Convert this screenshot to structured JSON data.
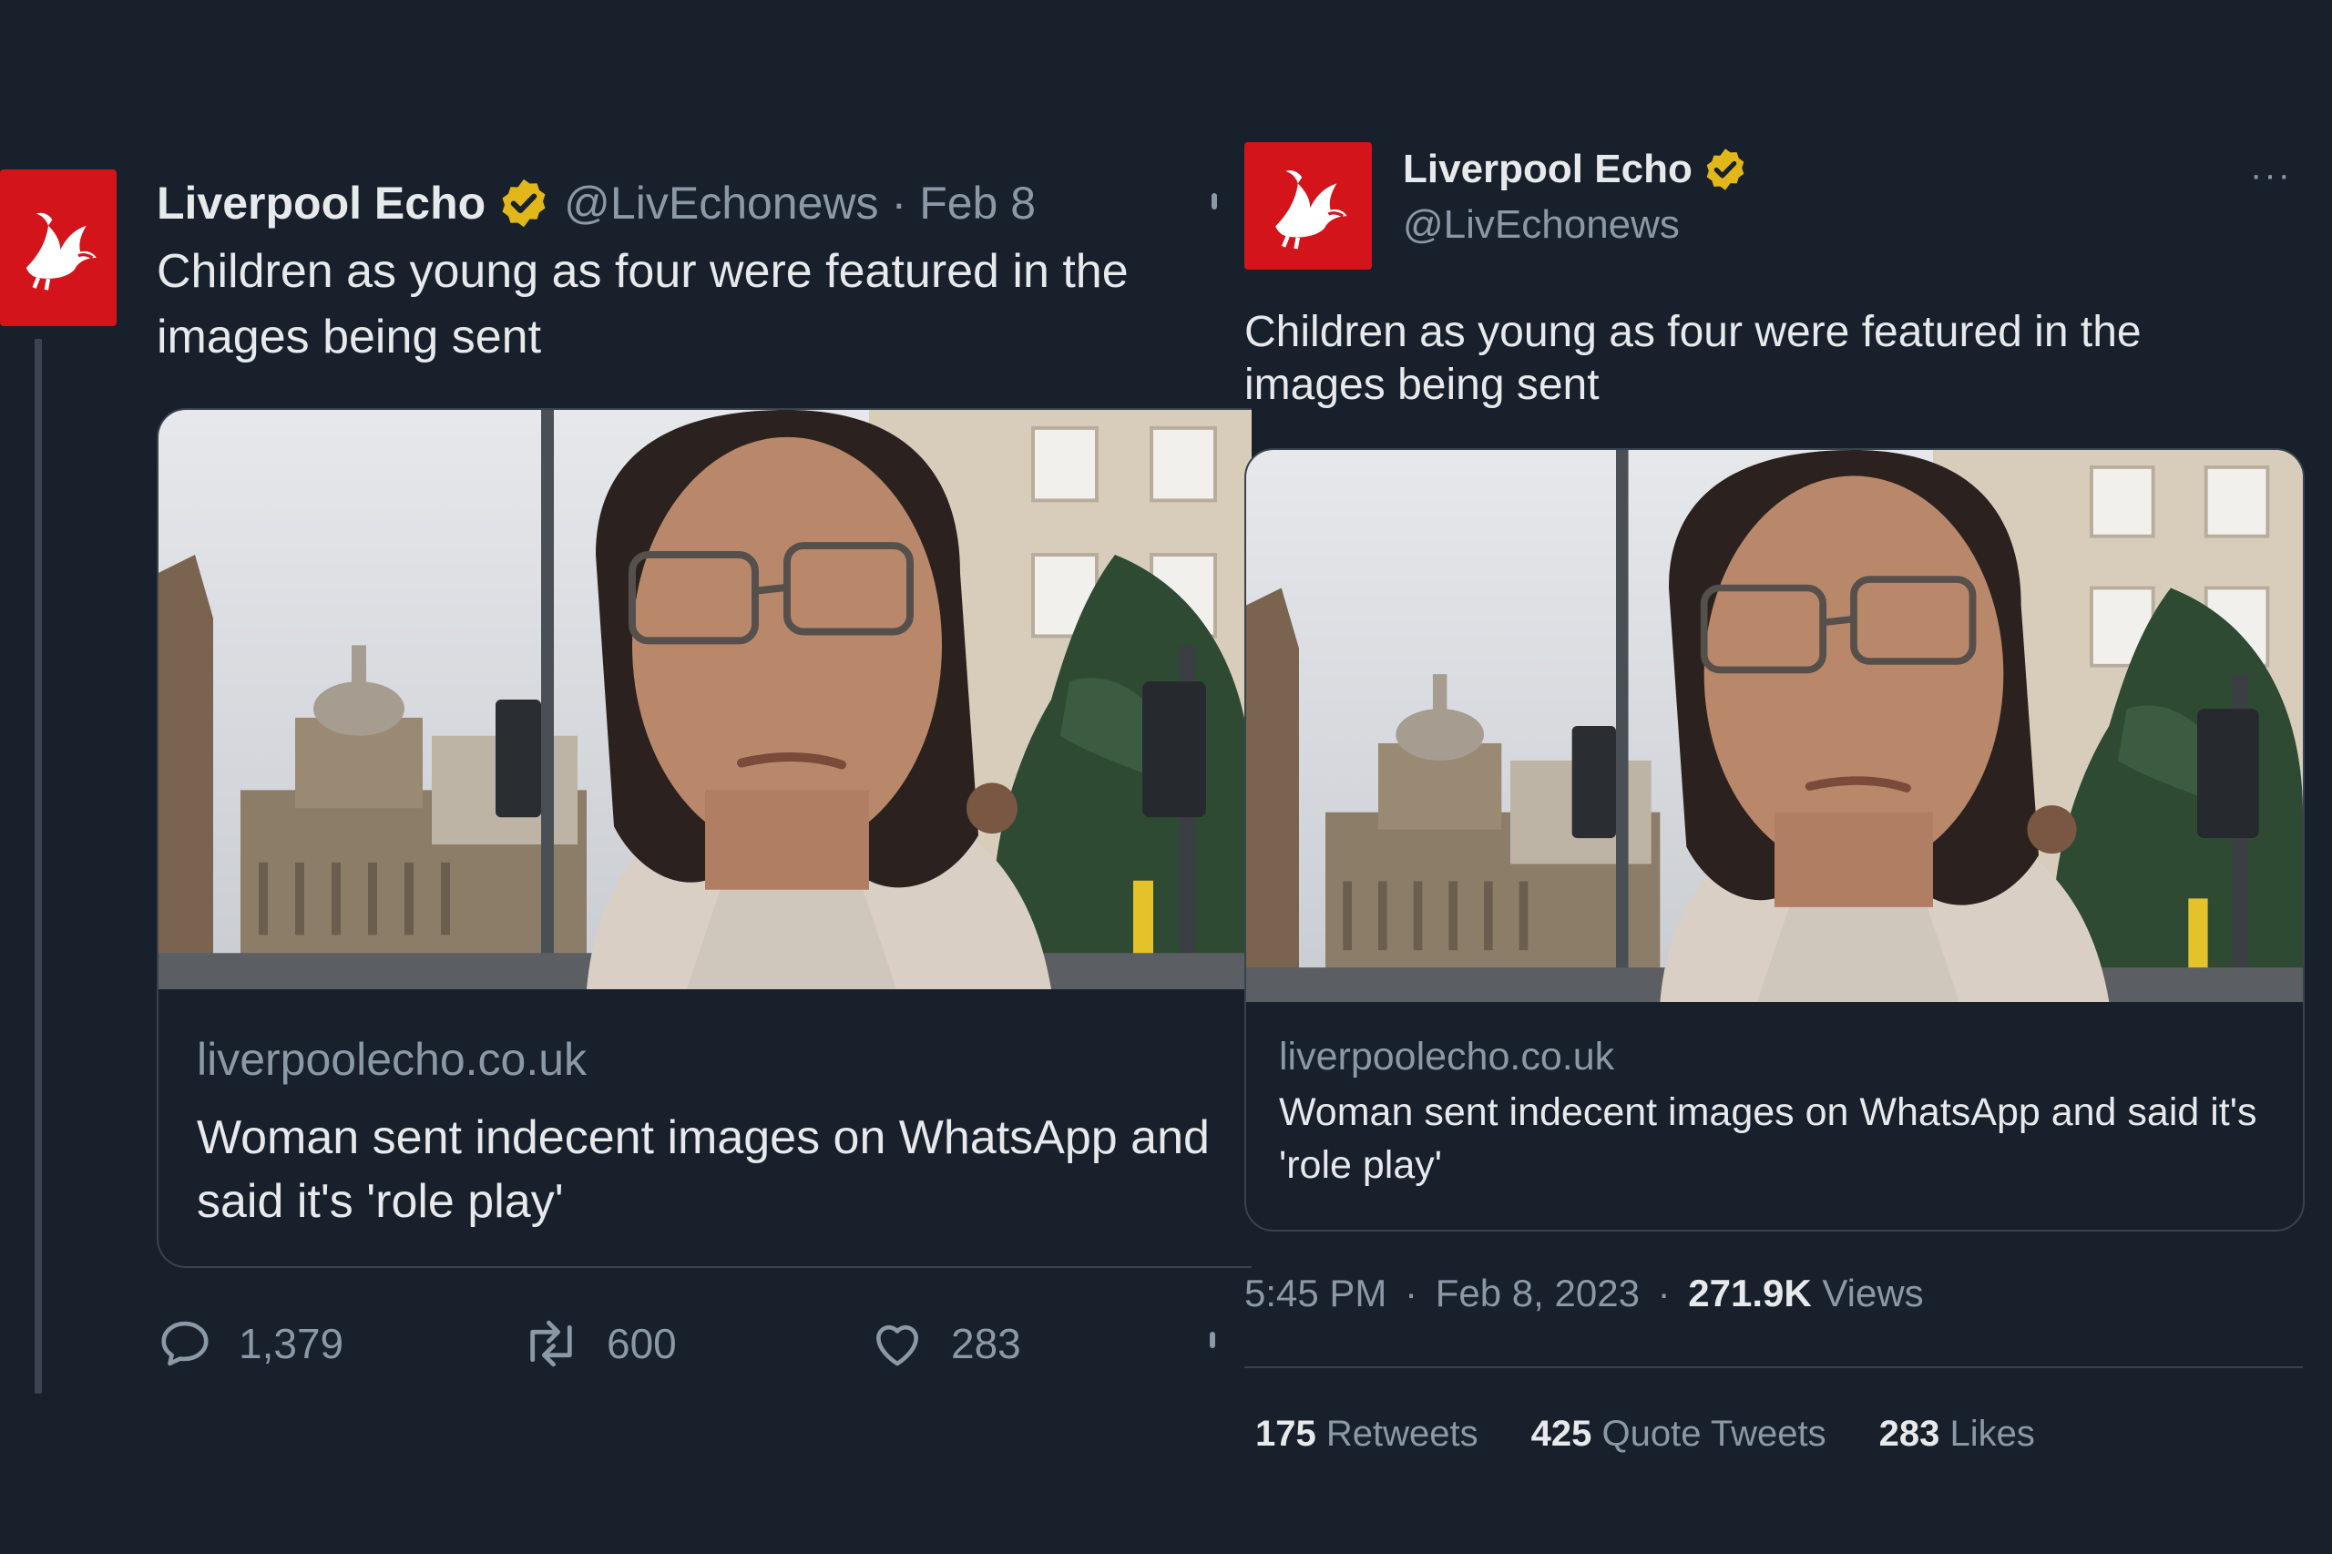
{
  "colors": {
    "background": "#17202b",
    "brand_red": "#d4141b",
    "verified_gold": "#e2b719",
    "muted_text": "#8b98a5",
    "border": "#38444d"
  },
  "left_tweet": {
    "name": "Liverpool Echo",
    "verified_icon": "verified-badge-icon",
    "handle": "@LivEchonews",
    "separator": "·",
    "date": "Feb 8",
    "text": "Children as young as four were featured in the images being sent",
    "card": {
      "domain": "liverpoolecho.co.uk",
      "title": "Woman sent indecent images on WhatsApp and said it's 'role play'"
    },
    "actions": {
      "replies": "1,379",
      "retweets": "600",
      "likes": "283"
    }
  },
  "right_tweet": {
    "name": "Liverpool Echo",
    "handle": "@LivEchonews",
    "more_label": "···",
    "text": "Children as young as four were featured in the images being sent",
    "card": {
      "domain": "liverpoolecho.co.uk",
      "title": "Woman sent indecent images on WhatsApp and said it's 'role play'"
    },
    "meta": {
      "time": "5:45 PM",
      "sep1": "·",
      "date": "Feb 8, 2023",
      "sep2": "·",
      "views_count": "271.9K",
      "views_label": "Views"
    },
    "stats": {
      "retweets_count": "175",
      "retweets_label": "Retweets",
      "quotes_count": "425",
      "quotes_label": "Quote Tweets",
      "likes_count": "283",
      "likes_label": "Likes"
    }
  }
}
